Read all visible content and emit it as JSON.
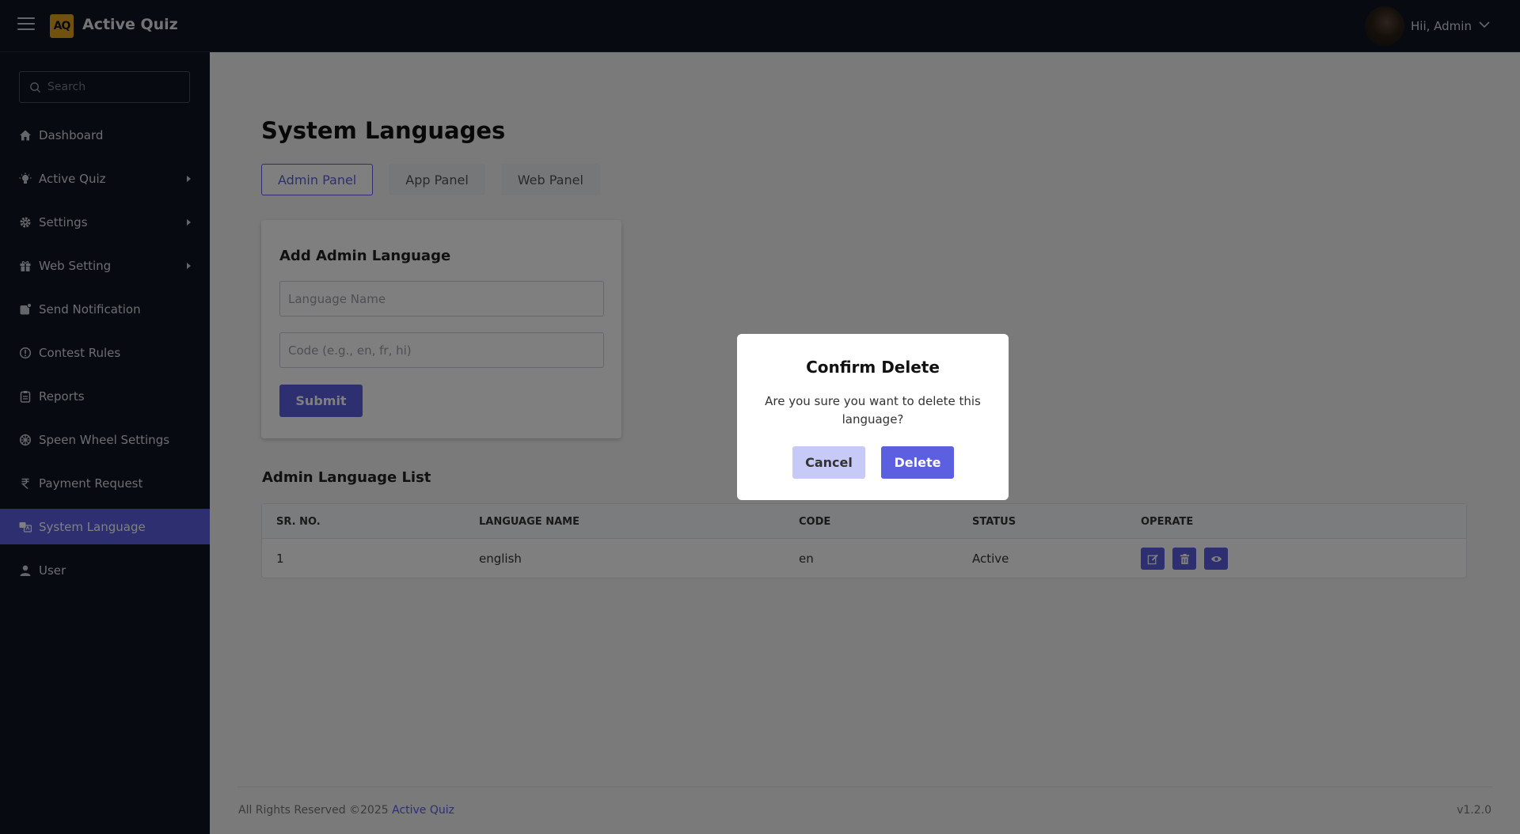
{
  "header": {
    "logo_text": "AQ",
    "app_title": "Active Quiz",
    "greeting": "Hii, Admin"
  },
  "sidebar": {
    "search_placeholder": "Search",
    "items": [
      {
        "label": "Dashboard",
        "icon": "home-icon"
      },
      {
        "label": "Active Quiz",
        "icon": "lightbulb-icon",
        "has_submenu": true
      },
      {
        "label": "Settings",
        "icon": "gear-icon",
        "has_submenu": true
      },
      {
        "label": "Web Setting",
        "icon": "gift-icon",
        "has_submenu": true
      },
      {
        "label": "Send Notification",
        "icon": "notification-icon"
      },
      {
        "label": "Contest Rules",
        "icon": "info-icon"
      },
      {
        "label": "Reports",
        "icon": "clipboard-icon"
      },
      {
        "label": "Speen Wheel Settings",
        "icon": "wheel-icon"
      },
      {
        "label": "Payment Request",
        "icon": "rupee-icon"
      },
      {
        "label": "System Language",
        "icon": "language-icon",
        "active": true
      },
      {
        "label": "User",
        "icon": "user-icon"
      }
    ]
  },
  "main": {
    "page_title": "System Languages",
    "tabs": [
      {
        "label": "Admin Panel",
        "active": true
      },
      {
        "label": "App Panel"
      },
      {
        "label": "Web Panel"
      }
    ],
    "form": {
      "title": "Add Admin Language",
      "name_placeholder": "Language Name",
      "code_placeholder": "Code (e.g., en, fr, hi)",
      "submit_label": "Submit"
    },
    "list": {
      "title": "Admin Language List",
      "columns": [
        "SR. NO.",
        "LANGUAGE NAME",
        "CODE",
        "STATUS",
        "OPERATE"
      ],
      "rows": [
        {
          "sr": "1",
          "name": "english",
          "code": "en",
          "status": "Active"
        }
      ]
    }
  },
  "footer": {
    "rights": "All Rights Reserved ©2025",
    "brand": "Active Quiz",
    "version": "v1.2.0"
  },
  "modal": {
    "title": "Confirm Delete",
    "message": "Are you sure you want to delete this language?",
    "cancel_label": "Cancel",
    "delete_label": "Delete"
  },
  "colors": {
    "accent": "#5b5fe0",
    "dark_bg": "#0f1420",
    "logo_gold": "#e0a21a"
  }
}
